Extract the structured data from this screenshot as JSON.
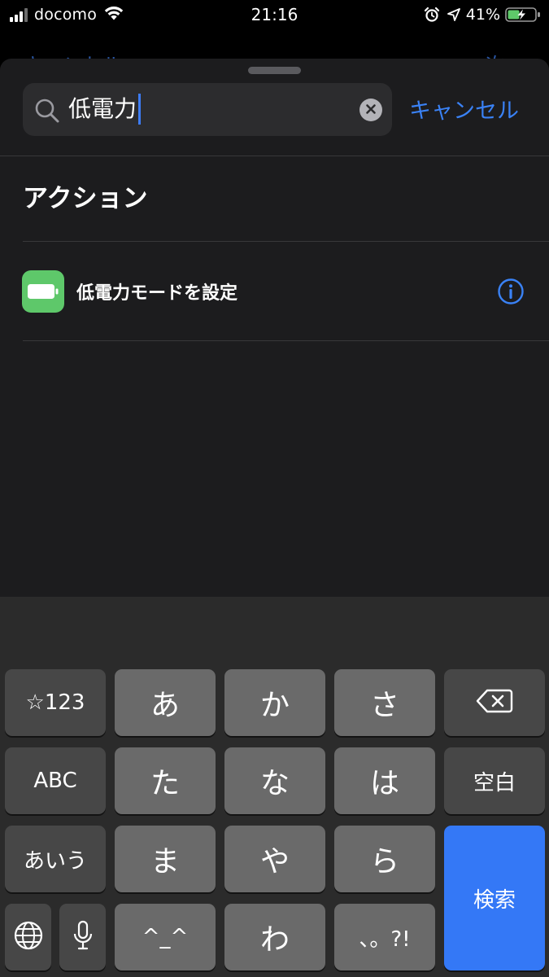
{
  "status_bar": {
    "carrier": "docomo",
    "time": "21:16",
    "battery_percent": "41%",
    "icons": [
      "signal-icon",
      "wifi-icon",
      "alarm-icon",
      "location-icon",
      "battery-charging-icon"
    ]
  },
  "behind": {
    "left_label": "キャンセル",
    "right_label": "次へ"
  },
  "search": {
    "value": "低電力",
    "cancel_label": "キャンセル"
  },
  "section": {
    "title": "アクション"
  },
  "results": [
    {
      "label": "低電力モードを設定",
      "icon": "battery-icon"
    }
  ],
  "keyboard": {
    "row1": [
      "☆123",
      "あ",
      "か",
      "さ"
    ],
    "row2": [
      "ABC",
      "た",
      "な",
      "は",
      "空白"
    ],
    "row3": [
      "あいう",
      "ま",
      "や",
      "ら"
    ],
    "row4": [
      "^_^",
      "わ",
      "、。?!"
    ],
    "search_key": "検索",
    "icons": [
      "globe-icon",
      "mic-icon",
      "delete-icon"
    ]
  },
  "colors": {
    "accent": "#3a82f6",
    "action_icon_bg": "#5ec86a",
    "sheet_bg": "#1c1c1e",
    "keyboard_bg": "#2b2b2b"
  }
}
